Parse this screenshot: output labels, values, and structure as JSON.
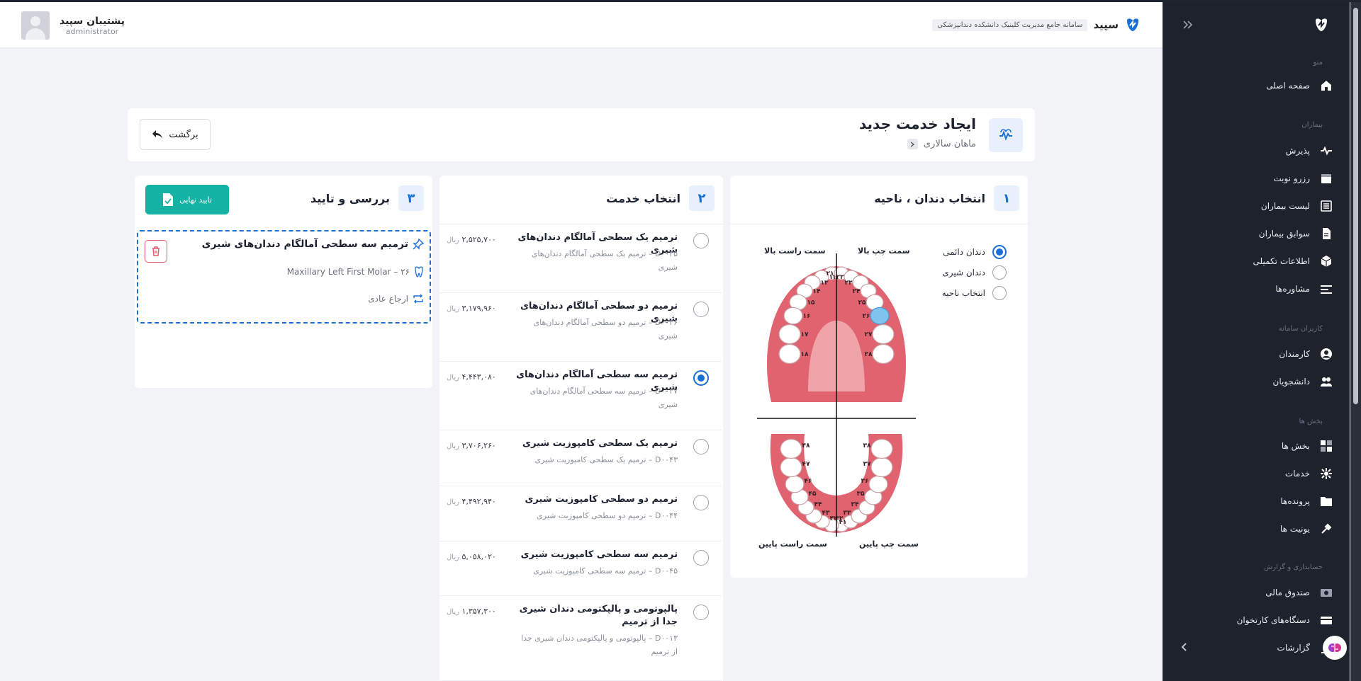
{
  "header": {
    "user_name": "پشتیبان سپید",
    "user_role": "administrator",
    "brand_name": "سپید",
    "brand_subtitle": "سامانه جامع مدیریت کلینیک دانشکده دندانپزشکی"
  },
  "sidebar": {
    "sections": {
      "menu": "منو",
      "patients": "بیماران",
      "system_users": "کاربران سامانه",
      "departments": "بخش ها",
      "accounting": "حسابداری و گزارش"
    },
    "items": [
      {
        "label": "صفحه اصلی",
        "icon": "home-icon"
      },
      {
        "label": "پذیرش",
        "icon": "heartbeat-icon"
      },
      {
        "label": "رزرو نوبت",
        "icon": "calendar-icon"
      },
      {
        "label": "لیست بیماران",
        "icon": "list-icon"
      },
      {
        "label": "سوابق بیماران",
        "icon": "document-icon"
      },
      {
        "label": "اطلاعات تکمیلی",
        "icon": "cube-icon"
      },
      {
        "label": "مشاوره‌ها",
        "icon": "consult-icon"
      },
      {
        "label": "کارمندان",
        "icon": "user-circle-icon"
      },
      {
        "label": "دانشجویان",
        "icon": "students-icon"
      },
      {
        "label": "بخش ها",
        "icon": "grid-icon"
      },
      {
        "label": "خدمات",
        "icon": "service-icon"
      },
      {
        "label": "پرونده‌ها",
        "icon": "folder-icon"
      },
      {
        "label": "یونیت ها",
        "icon": "unit-icon"
      },
      {
        "label": "صندوق مالی",
        "icon": "cashbox-icon"
      },
      {
        "label": "دستگاه‌های کارتخوان",
        "icon": "card-reader-icon"
      },
      {
        "label": "گزارشات",
        "icon": "report-icon"
      }
    ]
  },
  "page": {
    "title": "ایجاد خدمت جدید",
    "breadcrumb": "ماهان سالاری",
    "back_label": "برگشت"
  },
  "panel1": {
    "number": "۱",
    "title": "انتخاب دندان ، ناحیه",
    "options": [
      {
        "label": "دندان دائمی",
        "selected": true
      },
      {
        "label": "دندان شیری",
        "selected": false
      },
      {
        "label": "انتخاب ناحیه",
        "selected": false
      }
    ],
    "quadrants": {
      "upper_left": "سمت چپ بالا",
      "upper_right": "سمت راست بالا",
      "lower_left": "سمت چپ پایین",
      "lower_right": "سمت راست پایین"
    },
    "tooth_numbers": {
      "upper_right": [
        "۱۱",
        "۱۲",
        "۱۳",
        "۱۴",
        "۱۵",
        "۱۶",
        "۱۷",
        "۱۸"
      ],
      "upper_left": [
        "۲۱",
        "۲۲",
        "۲۳",
        "۲۴",
        "۲۵",
        "۲۶",
        "۲۷",
        "۲۸"
      ],
      "lower_left": [
        "۳۱",
        "۳۲",
        "۳۳",
        "۳۴",
        "۳۵",
        "۳۶",
        "۳۷",
        "۳۸"
      ],
      "lower_right": [
        "۴۱",
        "۴۲",
        "۴۳",
        "۴۴",
        "۴۵",
        "۴۶",
        "۴۷",
        "۴۸"
      ]
    },
    "selected_tooth": "۲۶",
    "colors": {
      "gum": "#e1636f",
      "selected": "#7fc4ee"
    }
  },
  "panel2": {
    "number": "۲",
    "title": "انتخاب خدمت",
    "currency": "ریال",
    "services": [
      {
        "title": "ترمیم یک سطحی آمالگام دندان‌های شیری",
        "desc": "D۰۰۳۵ – ترمیم یک سطحی آمالگام دندان‌های شیری",
        "price": "۲,۵۲۵,۷۰۰",
        "selected": false
      },
      {
        "title": "ترمیم دو سطحی آمالگام دندان‌های شیری",
        "desc": "D۰۰۳۶ – ترمیم دو سطحی آمالگام دندان‌های شیری",
        "price": "۳,۱۷۹,۹۶۰",
        "selected": false
      },
      {
        "title": "ترمیم سه سطحی آمالگام دندان‌های شیری",
        "desc": "D۰۰۳۷ – ترمیم سه سطحی آمالگام دندان‌های شیری",
        "price": "۴,۴۴۳,۰۸۰",
        "selected": true
      },
      {
        "title": "ترمیم یک سطحی کامپوزیت شیری",
        "desc": "D۰۰۴۳ – ترمیم یک سطحی کامپوزیت شیری",
        "price": "۳,۷۰۶,۲۶۰",
        "selected": false
      },
      {
        "title": "ترمیم دو سطحی کامپوزیت شیری",
        "desc": "D۰۰۴۴ – ترمیم دو سطحی کامپوزیت شیری",
        "price": "۴,۴۹۲,۹۴۰",
        "selected": false
      },
      {
        "title": "ترمیم سه سطحی کامپوزیت شیری",
        "desc": "D۰۰۴۵ – ترمیم سه سطحی کامپوزیت شیری",
        "price": "۵,۰۵۸,۰۲۰",
        "selected": false
      },
      {
        "title": "پالپوتومی و پالپکتومی دندان شیری جدا از ترمیم",
        "desc": "D۰۰۱۳ – پالپوتومی و پالپکتومی دندان شیری جدا از ترمیم",
        "price": "۱,۳۵۷,۳۰۰",
        "selected": false
      }
    ]
  },
  "panel3": {
    "number": "۳",
    "title": "بررسی و تایید",
    "confirm_label": "تایید نهایی",
    "selected_service": "ترمیم سه سطحی آمالگام دندان‌های شیری",
    "selected_tooth": "Maxillary Left First Molar – ۲۶",
    "referral": "ارجاع عادی"
  }
}
